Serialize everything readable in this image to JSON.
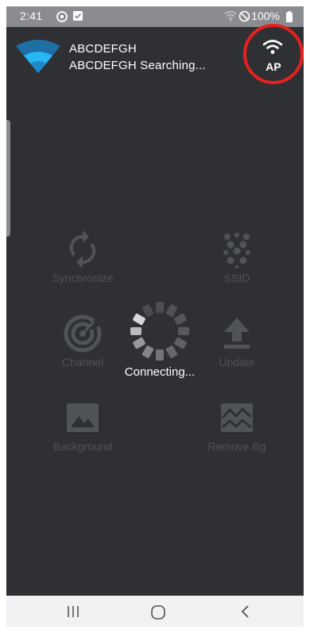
{
  "status_bar": {
    "time": "2:41",
    "battery": "100%",
    "icons": [
      "settings-sync-icon",
      "checkbox-notification-icon",
      "wifi-signal-icon",
      "do-not-disturb-icon",
      "battery-icon"
    ]
  },
  "header": {
    "device_name": "ABCDEFGH",
    "device_status": "ABCDEFGH Searching...",
    "logo_icon": "wifi-fan-logo-icon",
    "ap_button": {
      "label": "AP",
      "icon": "wifi-icon",
      "highlight_color": "#e8201f"
    }
  },
  "actions": [
    {
      "label": "Synchronize",
      "icon": "sync-icon"
    },
    {
      "label": "SSID",
      "icon": "dot-grid-icon"
    },
    {
      "label": "Channel",
      "icon": "radar-icon"
    },
    {
      "label": "Update",
      "icon": "upload-icon"
    },
    {
      "label": "Background",
      "icon": "image-icon"
    },
    {
      "label": "Remove Bg",
      "icon": "broken-image-icon"
    }
  ],
  "loading": {
    "text": "Connecting...",
    "icon": "spinner-icon"
  },
  "nav_bar": {
    "buttons": [
      "recent-apps-icon",
      "home-icon",
      "back-icon"
    ]
  },
  "colors": {
    "background": "#2f3033",
    "status_bar": "#8b8c8f",
    "disabled_icon": "#505357",
    "logo_blue": "#1e88c8",
    "logo_light_blue": "#29b6f6"
  }
}
